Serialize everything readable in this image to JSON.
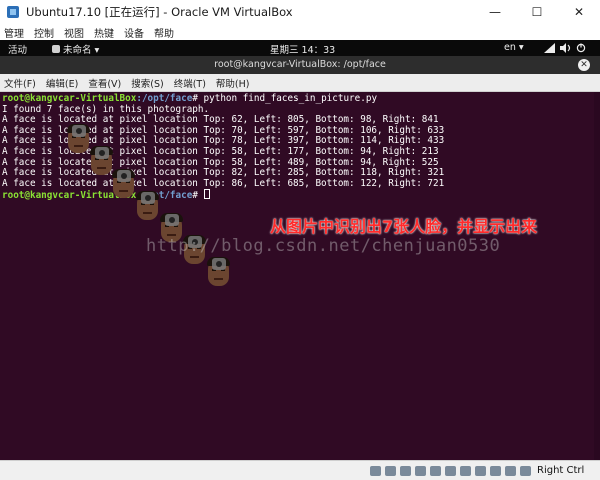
{
  "window": {
    "title": "Ubuntu17.10 [正在运行] - Oracle VM VirtualBox",
    "controls": {
      "minimize": "—",
      "maximize": "☐",
      "close": "✕"
    }
  },
  "vbox_menu": [
    "管理",
    "控制",
    "视图",
    "热键",
    "设备",
    "帮助"
  ],
  "gnome_panel": {
    "activities": "活动",
    "app_menu": "未命名 ▾",
    "clock": "星期三 14：33",
    "language": "en ▾",
    "power_menu": "▾"
  },
  "terminal": {
    "title": "root@kangvcar-VirtualBox: /opt/face",
    "menu": [
      "文件(F)",
      "编辑(E)",
      "查看(V)",
      "搜索(S)",
      "终端(T)",
      "帮助(H)"
    ],
    "prompt": {
      "user": "root@kangvcar-VirtualBox",
      "path": ":/opt/face",
      "symbol": "# "
    },
    "command": "python find_faces_in_picture.py",
    "summary": "I found 7 face(s) in this photograph.",
    "output_lines": [
      "A face is located at pixel location Top: 62, Left: 805, Bottom: 98, Right: 841",
      "A face is located at pixel location Top: 70, Left: 597, Bottom: 106, Right: 633",
      "A face is located at pixel location Top: 78, Left: 397, Bottom: 114, Right: 433",
      "A face is located at pixel location Top: 58, Left: 177, Bottom: 94, Right: 213",
      "A face is located at pixel location Top: 58, Left: 489, Bottom: 94, Right: 525",
      "A face is located at pixel location Top: 82, Left: 285, Bottom: 118, Right: 321",
      "A face is located at pixel location Top: 86, Left: 685, Bottom: 122, Right: 721"
    ]
  },
  "overlay": {
    "watermark": "http://blog.csdn.net/chenjuan0530",
    "annotation": "从图片中识别出7张人脸，并显示出来",
    "annotation_color": "#ff2b2b",
    "face_count": 7
  },
  "statusbar": {
    "host_key": "Right Ctrl"
  },
  "colors": {
    "terminal_bg": "#300a24",
    "prompt_user": "#8ae234",
    "prompt_path": "#729fcf"
  }
}
